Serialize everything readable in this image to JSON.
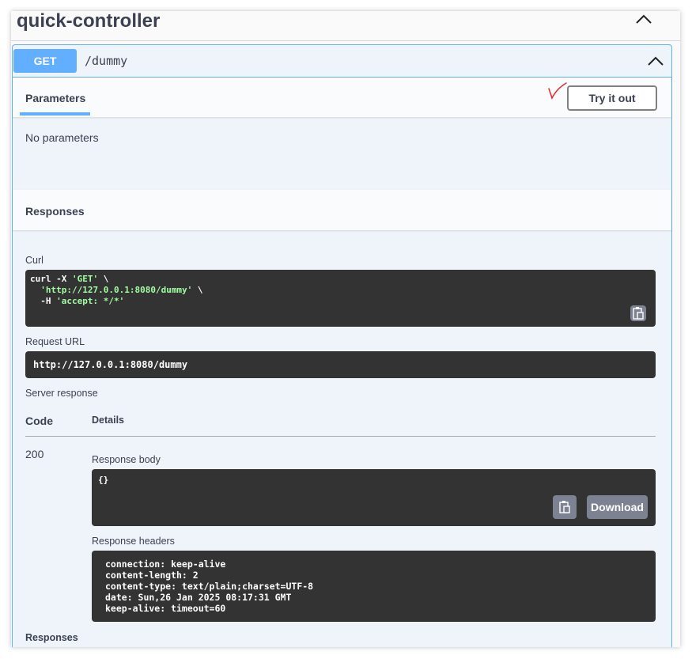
{
  "tag": {
    "title": "quick-controller"
  },
  "operation": {
    "method": "GET",
    "path": "/dummy",
    "accent_color": "#61affe"
  },
  "parameters": {
    "tab_label": "Parameters",
    "try_it_out_label": "Try it out",
    "empty_text": "No parameters"
  },
  "responses": {
    "section_label": "Responses",
    "curl_label": "Curl",
    "curl_lines": {
      "l1_cmd": "curl -X ",
      "l1_method": "'GET'",
      "l1_end": " \\",
      "l2_url": "'http://127.0.0.1:8080/dummy'",
      "l2_end": " \\",
      "l3_flag": "-H ",
      "l3_header": "'accept: */*'"
    },
    "request_url_label": "Request URL",
    "request_url": "http://127.0.0.1:8080/dummy",
    "server_response_label": "Server response",
    "code_header": "Code",
    "details_header": "Details",
    "status_code": "200",
    "response_body_label": "Response body",
    "response_body": "{}",
    "download_label": "Download",
    "response_headers_label": "Response headers",
    "response_headers": [
      "connection: keep-alive",
      "content-length: 2",
      "content-type: text/plain;charset=UTF-8",
      "date: Sun,26 Jan 2025 08:17:31 GMT",
      "keep-alive: timeout=60"
    ],
    "footer_label": "Responses"
  },
  "icons": {
    "tag_collapse": "chevron-up-icon",
    "op_collapse": "chevron-up-icon",
    "copy": "clipboard-copy-icon",
    "annotation": "red-check-mark-icon"
  }
}
